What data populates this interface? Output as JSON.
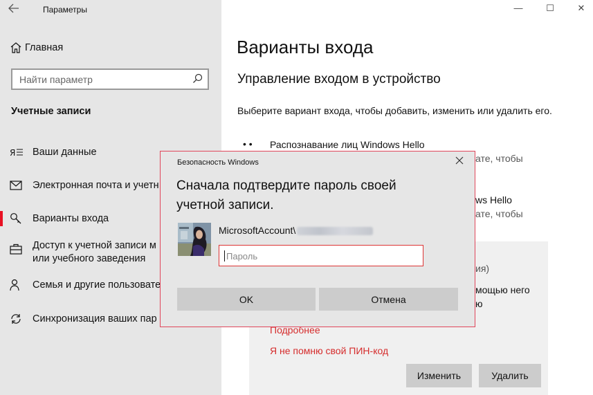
{
  "window": {
    "title": "Параметры",
    "controls": {
      "minimize": "—",
      "maximize": "☐",
      "close": "✕"
    }
  },
  "sidebar": {
    "home_label": "Главная",
    "search_placeholder": "Найти параметр",
    "section_title": "Учетные записи",
    "items": [
      {
        "label": "Ваши данные",
        "icon": "person-card-icon"
      },
      {
        "label": "Электронная почта и учетн",
        "icon": "envelope-icon"
      },
      {
        "label": "Варианты входа",
        "icon": "key-icon",
        "selected": true
      },
      {
        "label_line1": "Доступ к учетной записи м",
        "label_line2": "или учебного заведения",
        "icon": "briefcase-icon"
      },
      {
        "label": "Семья и другие пользовате",
        "icon": "people-icon"
      },
      {
        "label": "Синхронизация ваших пар",
        "icon": "sync-icon"
      }
    ],
    "accent_color": "#e81123"
  },
  "main": {
    "title": "Варианты входа",
    "subtitle": "Управление входом в устройство",
    "description": "Выберите вариант входа, чтобы добавить, изменить или удалить его.",
    "options": [
      {
        "bullet": "• •",
        "name": "Распознавание лиц Windows Hello",
        "desc_partial": "ате, чтобы"
      },
      {
        "name_partial": "ws Hello",
        "desc_partial": "ате, чтобы"
      }
    ],
    "pin_panel": {
      "line1_partial": "ия)",
      "line2_partial": "мощью него",
      "line3_partial": "ю",
      "more_link": "Подробнее",
      "forgot_link": "Я не помню свой ПИН-код",
      "change_button": "Изменить",
      "remove_button": "Удалить"
    }
  },
  "dialog": {
    "caption": "Безопасность Windows",
    "heading": "Сначала подтвердите пароль своей учетной записи.",
    "account_prefix": "MicrosoftAccount\\",
    "password_placeholder": "Пароль",
    "ok_button": "OK",
    "cancel_button": "Отмена",
    "border_color": "#e0455a"
  }
}
